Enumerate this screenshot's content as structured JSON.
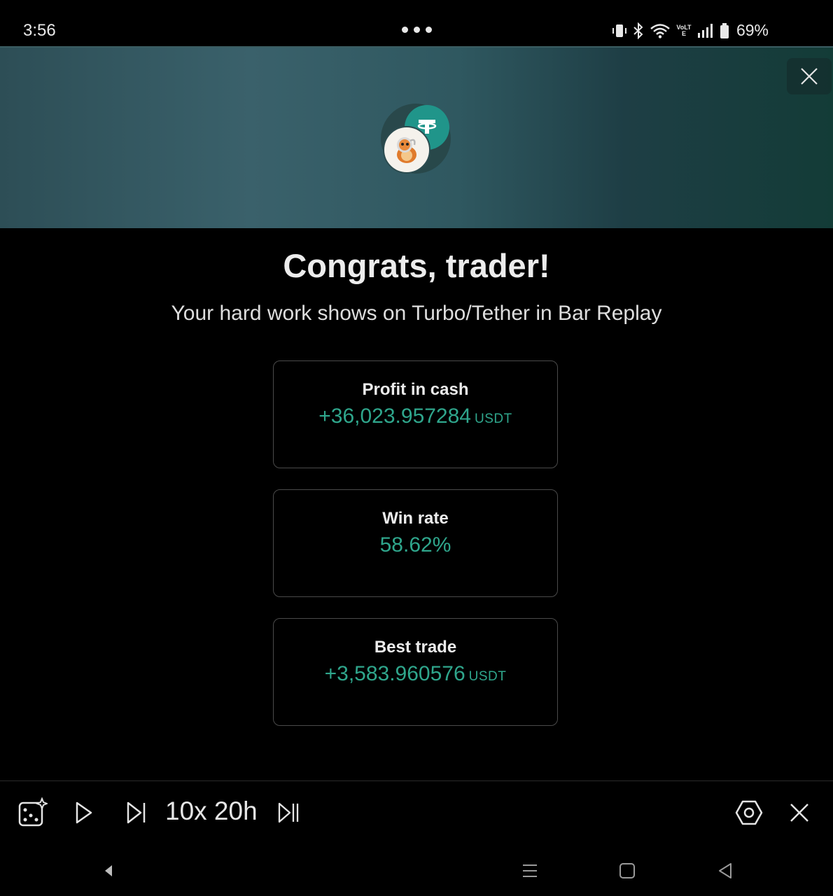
{
  "status_bar": {
    "time": "3:56",
    "battery": "69%",
    "network": "VoLTE"
  },
  "header": {
    "close_icon": "close-icon",
    "tokens": [
      "tether-icon",
      "turbo-icon"
    ]
  },
  "main": {
    "title": "Congrats, trader!",
    "subtitle": "Your hard work shows on Turbo/Tether in Bar Replay",
    "stats": [
      {
        "label": "Profit in cash",
        "value": "+36,023.957284",
        "unit": "USDT"
      },
      {
        "label": "Win rate",
        "value": "58.62%",
        "unit": ""
      },
      {
        "label": "Best trade",
        "value": "+3,583.960576",
        "unit": "USDT"
      }
    ]
  },
  "toolbar": {
    "speed_label": "10x 20h",
    "icons": [
      "random-bar-icon",
      "play-icon",
      "step-forward-icon",
      "jump-to-realtime-icon",
      "settings-icon",
      "close-icon"
    ]
  },
  "colors": {
    "accent_green": "#2fa68c",
    "banner_start": "#2d4e56",
    "banner_end": "#133c37",
    "tether": "#20958a"
  }
}
